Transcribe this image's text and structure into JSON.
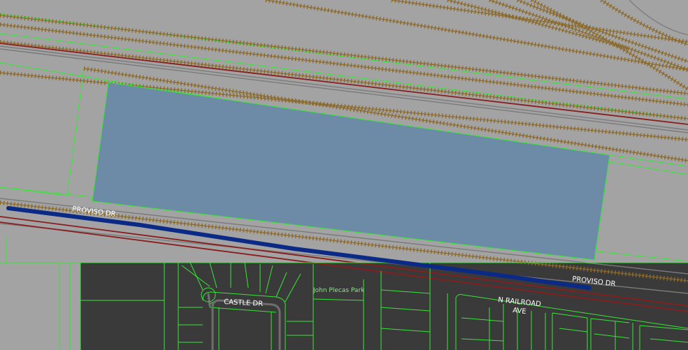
{
  "map": {
    "colors": {
      "background": "#a3a3a3",
      "dark_area": "#3a3a3a",
      "parcel_line": "#37e637",
      "rail_brown": "#8c6a2c",
      "rail_red": "#8a1d1d",
      "highlight_fill": "#6a8aa8",
      "route_blue": "#0b2a86",
      "label_light": "#ffffff",
      "label_park": "#7df07d"
    },
    "labels": {
      "proviso_dr_west": "PROVISO DR",
      "proviso_dr_east": "PROVISO DR",
      "castle_dr": "CASTLE DR",
      "park": "John Plecas Park",
      "n_railroad_line1": "N RAILROAD",
      "n_railroad_line2": "AVE"
    }
  }
}
